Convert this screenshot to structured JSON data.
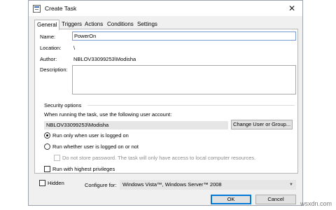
{
  "window": {
    "title": "Create Task",
    "close_glyph": "✕"
  },
  "tabs": [
    {
      "label": "General",
      "active": true
    },
    {
      "label": "Triggers",
      "active": false
    },
    {
      "label": "Actions",
      "active": false
    },
    {
      "label": "Conditions",
      "active": false
    },
    {
      "label": "Settings",
      "active": false
    }
  ],
  "general": {
    "name_label": "Name:",
    "name_value": "PowerOn",
    "location_label": "Location:",
    "location_value": "\\",
    "author_label": "Author:",
    "author_value": "NBLOV33099253\\Modisha",
    "description_label": "Description:",
    "description_value": ""
  },
  "security": {
    "group_title": "Security options",
    "account_prompt": "When running the task, use the following user account:",
    "account_value": "NBLOV33099253\\Modisha",
    "change_button": "Change User or Group...",
    "radio_logged_on": "Run only when user is logged on",
    "radio_logged_on_checked": true,
    "radio_whether": "Run whether user is logged on or not",
    "radio_whether_checked": false,
    "no_store_password": "Do not store password.  The task will only have access to local computer resources.",
    "highest_privileges": "Run with highest privileges"
  },
  "footer": {
    "hidden_label": "Hidden",
    "configure_label": "Configure for:",
    "configure_value": "Windows Vista™, Windows Server™ 2008",
    "ok_button": "OK",
    "cancel_button": "Cancel"
  },
  "watermark": "wsxdn.com",
  "colors": {
    "focus_border": "#7a9cd3",
    "primary_accent": "#0078d7"
  }
}
